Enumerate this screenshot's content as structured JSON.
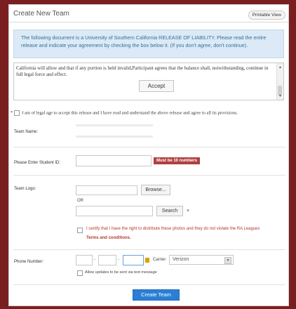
{
  "header": {
    "title": "Create New Team",
    "printable_label": "Printable View"
  },
  "notice": {
    "text": "The following document is a University of Southern California RELEASE OF LIABILITY. Please read the entire release and indicate your agreement by checking the box below it. (If you don't agree, don't continue)."
  },
  "release": {
    "text": "California will allow and that if any portion is held invalid,Participant agrees that the balance shall, notwithstanding, continue in full legal force and effect.",
    "accept_label": "Accept"
  },
  "agreement": {
    "required_mark": "*",
    "label": "I am of legal age to accept this release and I have read and understand the above release and agree to all its provisions."
  },
  "team_name": {
    "label": "Team Name:"
  },
  "student_id": {
    "label": "Please Enter Student ID:",
    "badge": "Must be 10 numbers",
    "badge_color": "#b04040"
  },
  "team_logo": {
    "label": "Team Logo:",
    "browse_label": "Browse...",
    "or_label": "OR",
    "search_label": "Search",
    "clear_label": "×",
    "certify_label": "I certify that I have the right to distribute these photos and they do not violate the RA Leagues",
    "terms_label": "Terms and conditions."
  },
  "phone": {
    "label": "Phone Number:",
    "dash": "-",
    "carrier_label": "Carrier",
    "carrier_value": "Verizon",
    "updates_label": "Allow updates to be sent via text message"
  },
  "create_button": {
    "label": "Create Team",
    "color": "#2a7fd4"
  }
}
